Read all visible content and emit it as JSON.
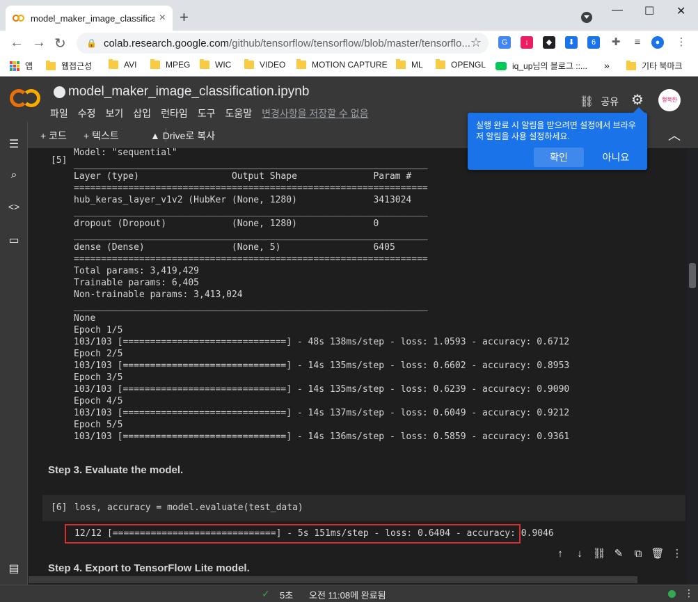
{
  "browser": {
    "tab_title": "model_maker_image_classificatio",
    "tab_close": "×",
    "new_tab": "+",
    "url_host": "colab.research.google.com",
    "url_path": "/github/tensorflow/tensorflow/blob/master/tensorflo...",
    "window_min": "—",
    "window_max": "☐",
    "window_close": "✕",
    "back": "←",
    "forward": "→",
    "reload": "↻",
    "lock": "🔒",
    "star": "☆",
    "ext_badge": "6",
    "bookmarks": [
      {
        "label": "앱"
      },
      {
        "label": "웹접근성"
      },
      {
        "label": "AVI"
      },
      {
        "label": "MPEG"
      },
      {
        "label": "WIC"
      },
      {
        "label": "VIDEO"
      },
      {
        "label": "MOTION CAPTURE"
      },
      {
        "label": "ML"
      },
      {
        "label": "OPENGL"
      },
      {
        "label": "iq_up님의 블로그 ::..."
      },
      {
        "label": "기타 북마크"
      }
    ],
    "bookmarks_more": "»"
  },
  "colab": {
    "logo_text": "CO",
    "notebook_title": "model_maker_image_classification.ipynb",
    "menu": [
      "파일",
      "수정",
      "보기",
      "삽입",
      "런타임",
      "도구",
      "도움말"
    ],
    "unsaved": "변경사항을 저장할 수 없음",
    "share": "공유",
    "avatar_text": "행복한"
  },
  "toolbar": {
    "add_code": "+ 코드",
    "add_text": "+ 텍스트",
    "copy_drive": "Drive로 복사",
    "collapse": "︿"
  },
  "notification": {
    "message": "실행 완료 시 알림을 받으려면 설정에서 브라우저 알림을 사용 설정하세요.",
    "confirm": "확인",
    "decline": "아니요"
  },
  "cell5": {
    "label": "[5]",
    "lines": [
      "Model: \"sequential\"",
      "_________________________________________________________________",
      "Layer (type)                 Output Shape              Param #   ",
      "=================================================================",
      "hub_keras_layer_v1v2 (HubKer (None, 1280)              3413024   ",
      "_________________________________________________________________",
      "dropout (Dropout)            (None, 1280)              0         ",
      "_________________________________________________________________",
      "dense (Dense)                (None, 5)                 6405      ",
      "=================================================================",
      "Total params: 3,419,429",
      "Trainable params: 6,405",
      "Non-trainable params: 3,413,024",
      "_________________________________________________________________",
      "None",
      "Epoch 1/5",
      "103/103 [==============================] - 48s 138ms/step - loss: 1.0593 - accuracy: 0.6712",
      "Epoch 2/5",
      "103/103 [==============================] - 14s 135ms/step - loss: 0.6602 - accuracy: 0.8953",
      "Epoch 3/5",
      "103/103 [==============================] - 14s 135ms/step - loss: 0.6239 - accuracy: 0.9090",
      "Epoch 4/5",
      "103/103 [==============================] - 14s 137ms/step - loss: 0.6049 - accuracy: 0.9212",
      "Epoch 5/5",
      "103/103 [==============================] - 14s 136ms/step - loss: 0.5859 - accuracy: 0.9361"
    ]
  },
  "step3": "Step 3. Evaluate the model.",
  "cell6": {
    "label": "[6]",
    "code": "loss, accuracy = model.evaluate(test_data)",
    "output": "12/12 [==============================] - 5s 151ms/step - loss: 0.6404 - accuracy: 0.9046"
  },
  "step4": "Step 4. Export to TensorFlow Lite model.",
  "status": {
    "check": "✓",
    "duration": "5초",
    "text": "오전 11:08에 완료됨"
  },
  "colors": {
    "accent": "#1a73e8",
    "highlight_border": "#d32f2f",
    "status_ok": "#34a853"
  }
}
